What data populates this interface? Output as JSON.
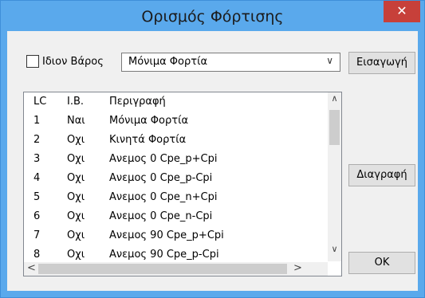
{
  "window": {
    "title": "Ορισμός Φόρτισης",
    "close_glyph": "✕"
  },
  "self_weight": {
    "label": "Ιδιον Βάρος",
    "checked": false
  },
  "load_case_select": {
    "value": "Μόνιμα Φορτία"
  },
  "buttons": {
    "insert": "Εισαγωγή",
    "delete": "Διαγραφή",
    "ok": "OK"
  },
  "table": {
    "headers": [
      "LC",
      "Ι.Β.",
      "Περιγραφή"
    ],
    "rows": [
      [
        "1",
        "Ναι",
        "Μόνιμα Φορτία"
      ],
      [
        "2",
        "Οχι",
        "Κινητά Φορτία"
      ],
      [
        "3",
        "Οχι",
        "Ανεμος 0 Cpe_p+Cpi"
      ],
      [
        "4",
        "Οχι",
        "Ανεμος 0 Cpe_p-Cpi"
      ],
      [
        "5",
        "Οχι",
        "Ανεμος 0 Cpe_n+Cpi"
      ],
      [
        "6",
        "Οχι",
        "Ανεμος 0 Cpe_n-Cpi"
      ],
      [
        "7",
        "Οχι",
        "Ανεμος 90 Cpe_p+Cpi"
      ],
      [
        "8",
        "Οχι",
        "Ανεμος 90 Cpe_p-Cpi"
      ]
    ]
  },
  "icons": {
    "close": "close-icon",
    "dropdown": "chevron-down-icon",
    "scroll_up": "chevron-up-icon",
    "scroll_down": "chevron-down-icon",
    "scroll_left": "chevron-left-icon",
    "scroll_right": "chevron-right-icon"
  },
  "colors": {
    "titlebar": "#5aa9ec",
    "close": "#c7403a",
    "client": "#f0f0f0"
  }
}
